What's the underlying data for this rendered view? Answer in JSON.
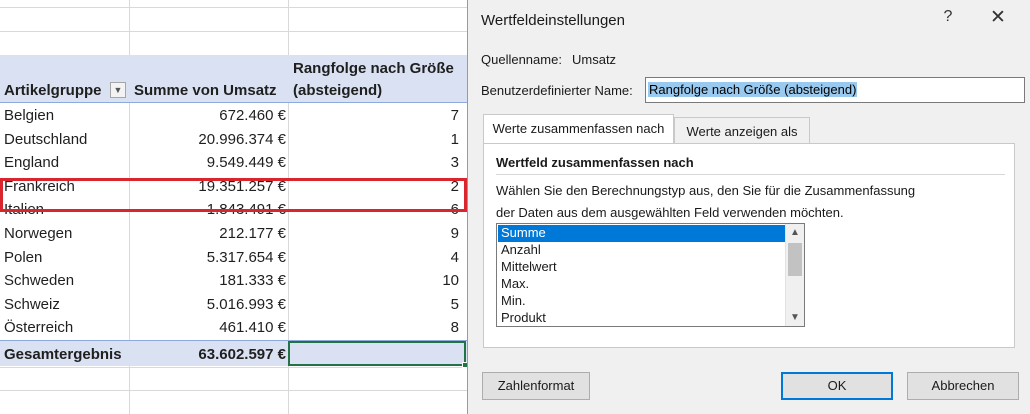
{
  "pivot": {
    "headers": {
      "group": "Artikelgruppe",
      "sum": "Summe von Umsatz",
      "rank_line1": "Rangfolge nach Größe",
      "rank_line2": "(absteigend)"
    },
    "filter_icon": "dropdown-arrow-icon",
    "rows": [
      {
        "group": "Belgien",
        "sum": "672.460 €",
        "rank": "7"
      },
      {
        "group": "Deutschland",
        "sum": "20.996.374 €",
        "rank": "1"
      },
      {
        "group": "England",
        "sum": "9.549.449 €",
        "rank": "3"
      },
      {
        "group": "Frankreich",
        "sum": "19.351.257 €",
        "rank": "2"
      },
      {
        "group": "Italien",
        "sum": "1.843.491 €",
        "rank": "6"
      },
      {
        "group": "Norwegen",
        "sum": "212.177 €",
        "rank": "9"
      },
      {
        "group": "Polen",
        "sum": "5.317.654 €",
        "rank": "4"
      },
      {
        "group": "Schweden",
        "sum": "181.333 €",
        "rank": "10"
      },
      {
        "group": "Schweiz",
        "sum": "5.016.993 €",
        "rank": "5"
      },
      {
        "group": "Österreich",
        "sum": "461.410 €",
        "rank": "8"
      }
    ],
    "total": {
      "label": "Gesamtergebnis",
      "sum": "63.602.597 €"
    },
    "highlighted_row": "Deutschland",
    "colors": {
      "header_bg": "#d9e1f2",
      "highlight_border": "#d9262e",
      "selection": "#217346"
    }
  },
  "dialog": {
    "title": "Wertfeldeinstellungen",
    "help_label": "?",
    "close_label": "✕",
    "source_label": "Quellenname:",
    "source_value": "Umsatz",
    "custom_name_label": "Benutzerdefinierter Name:",
    "custom_name_value": "Rangfolge nach Größe (absteigend)",
    "tabs": [
      {
        "label": "Werte zusammenfassen nach",
        "active": true
      },
      {
        "label": "Werte anzeigen als",
        "active": false
      }
    ],
    "section_title": "Wertfeld zusammenfassen nach",
    "description_line1": "Wählen Sie den Berechnungstyp aus, den Sie für die Zusammenfassung",
    "description_line2": "der Daten aus dem ausgewählten Feld verwenden möchten.",
    "list_items": [
      "Summe",
      "Anzahl",
      "Mittelwert",
      "Max.",
      "Min.",
      "Produkt"
    ],
    "selected_item": "Summe",
    "buttons": {
      "number_format": "Zahlenformat",
      "ok": "OK",
      "cancel": "Abbrechen"
    },
    "colors": {
      "selection": "#0078d7",
      "name_highlight": "#99c9ef"
    }
  }
}
